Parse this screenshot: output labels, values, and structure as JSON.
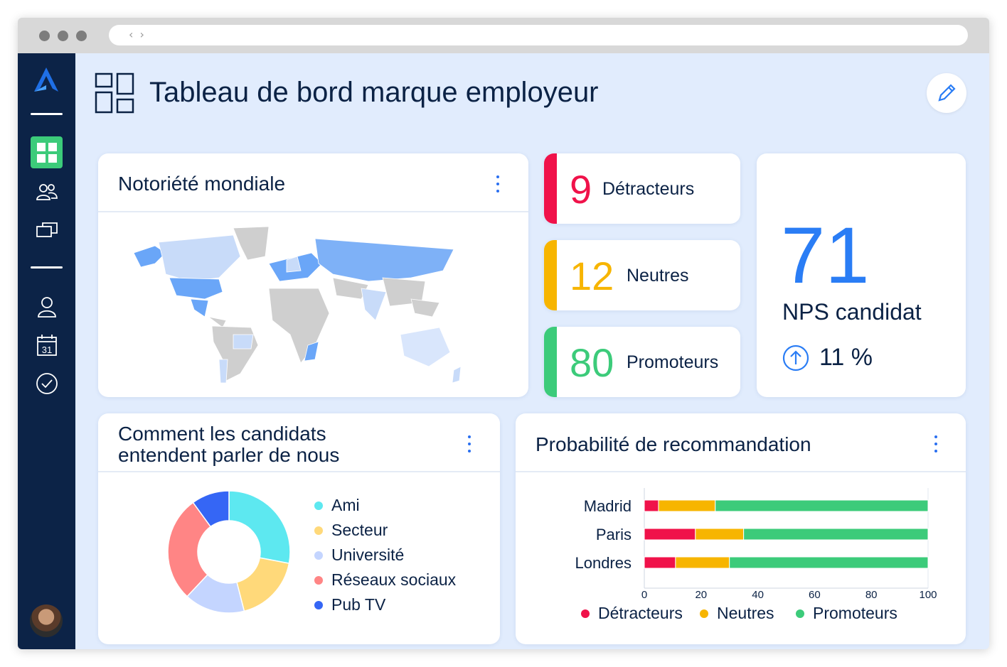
{
  "page_title": "Tableau de bord marque employeur",
  "map_card": {
    "title": "Notoriété mondiale"
  },
  "kpis": [
    {
      "value": "9",
      "label": "Détracteurs",
      "color": "#f0124a"
    },
    {
      "value": "12",
      "label": "Neutres",
      "color": "#f7b500"
    },
    {
      "value": "80",
      "label": "Promoteurs",
      "color": "#3ccb7a"
    }
  ],
  "nps": {
    "value": "71",
    "label": "NPS candidat",
    "trend": "11 %"
  },
  "source_card": {
    "title_line1": "Comment les candidats",
    "title_line2": "entendent parler de nous"
  },
  "rec_card": {
    "title": "Probabilité de recommandation"
  },
  "colors": {
    "sidebar": "#0c2347",
    "accent": "#2a7df5",
    "active": "#3ccb7a"
  },
  "chart_data": [
    {
      "type": "pie",
      "categories": [
        "Ami",
        "Secteur",
        "Université",
        "Réseaux sociaux",
        "Pub TV"
      ],
      "values": [
        28,
        18,
        16,
        28,
        10
      ],
      "colors": [
        "#5de8f0",
        "#ffd97a",
        "#c4d5ff",
        "#ff8585",
        "#3566f5"
      ],
      "legend": "right"
    },
    {
      "type": "bar",
      "orientation": "horizontal",
      "stacked": true,
      "categories": [
        "Madrid",
        "Paris",
        "Londres"
      ],
      "series": [
        {
          "name": "Détracteurs",
          "values": [
            5,
            18,
            11
          ],
          "color": "#f0124a"
        },
        {
          "name": "Neutres",
          "values": [
            20,
            17,
            19
          ],
          "color": "#f7b500"
        },
        {
          "name": "Promoteurs",
          "values": [
            75,
            65,
            70
          ],
          "color": "#3ccb7a"
        }
      ],
      "xlim": [
        0,
        100
      ],
      "xticks": [
        "0",
        "20",
        "40",
        "60",
        "80",
        "100"
      ],
      "legend": "bottom"
    }
  ]
}
